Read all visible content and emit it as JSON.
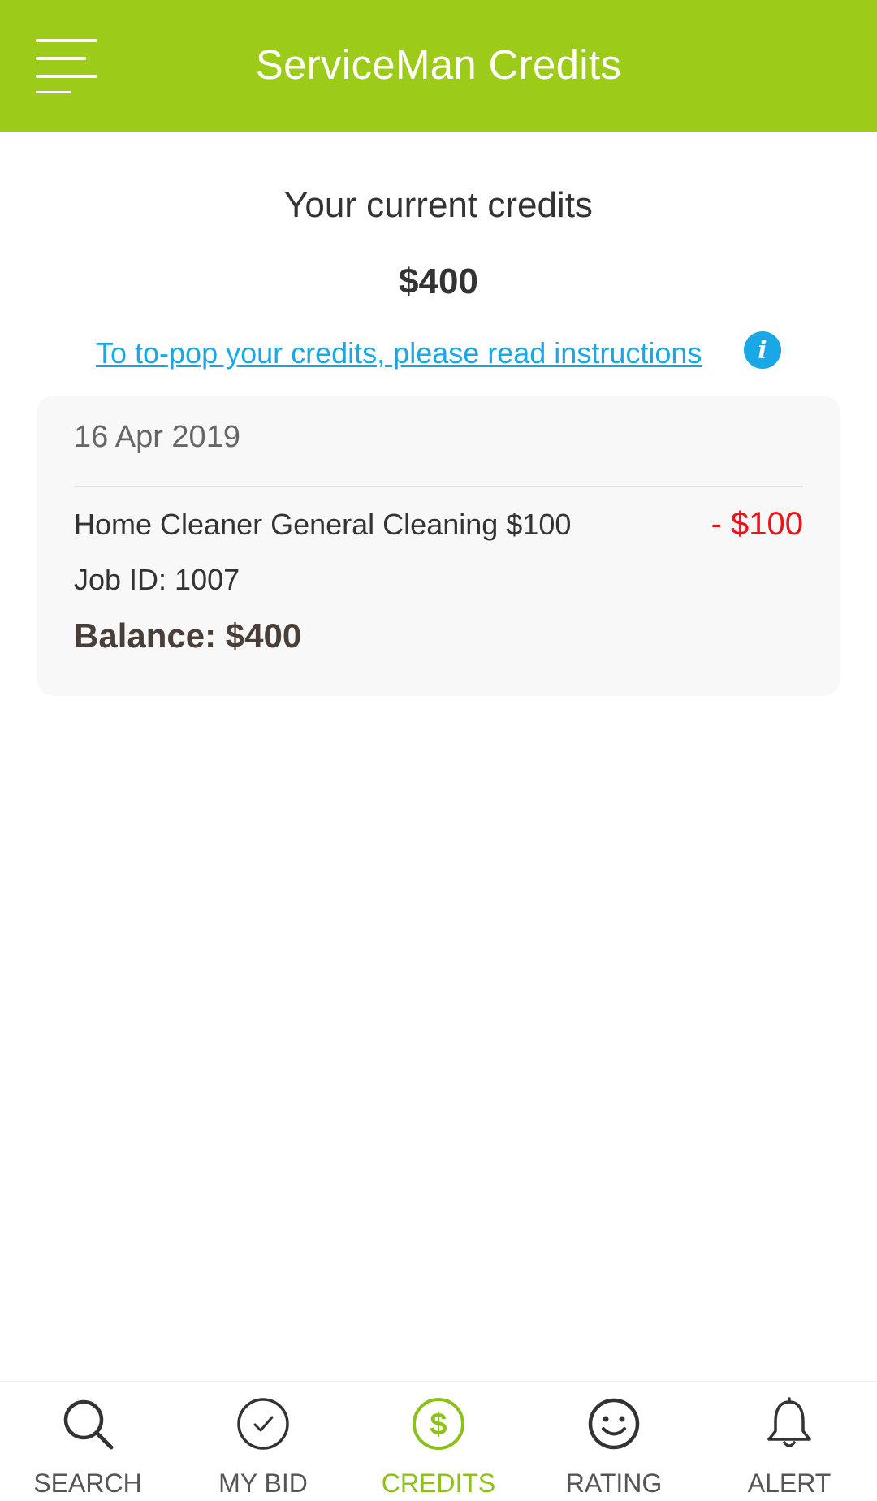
{
  "appbar": {
    "title": "ServiceMan Credits",
    "menu_icon": "menu-icon",
    "color": "#9dcb1a"
  },
  "summary": {
    "label": "Your current credits",
    "amount": "$400",
    "instructions_link": "To to-pop your credits, please read instructions",
    "info_icon": "info-icon"
  },
  "transactions": [
    {
      "date": "16 Apr 2019",
      "description": "Home Cleaner General Cleaning $100",
      "amount": "- $100",
      "job_id": "Job ID: 1007",
      "balance": "Balance: $400"
    }
  ],
  "bottom_nav": {
    "active_color": "#8cc11a",
    "items": [
      {
        "label": "SEARCH",
        "icon": "search-icon",
        "active": false
      },
      {
        "label": "MY BID",
        "icon": "check-circle-icon",
        "active": false
      },
      {
        "label": "CREDITS",
        "icon": "dollar-circle-icon",
        "active": true
      },
      {
        "label": "RATING",
        "icon": "smiley-icon",
        "active": false
      },
      {
        "label": "ALERT",
        "icon": "bell-icon",
        "active": false
      }
    ]
  }
}
